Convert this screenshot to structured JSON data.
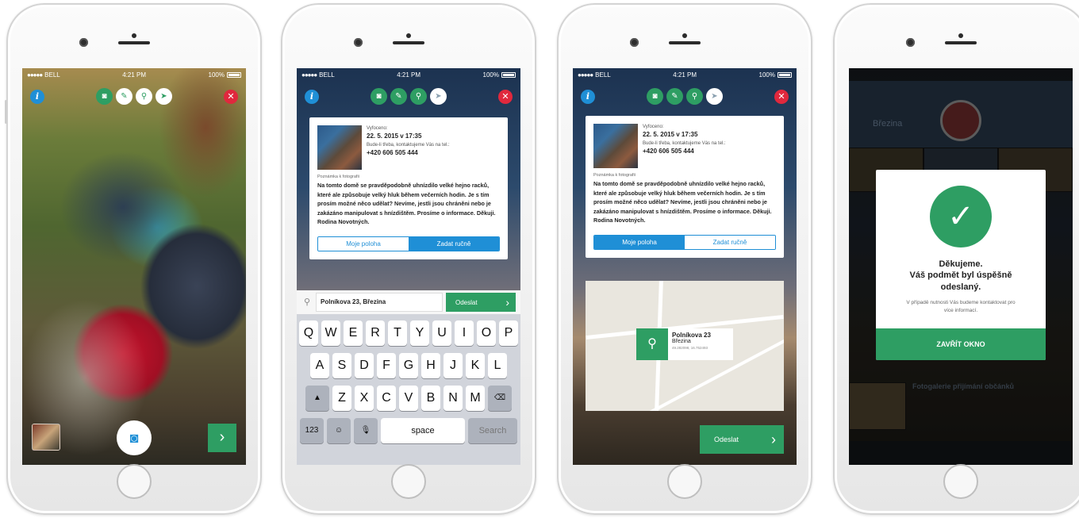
{
  "status": {
    "carrier": "BELL",
    "time": "4:21 PM",
    "battery": "100%"
  },
  "toolbar": {
    "info": "i",
    "close": "✕"
  },
  "screen1": {
    "next": "›"
  },
  "card": {
    "sent_label": "Vyfoceno:",
    "sent_date": "22. 5. 2015 v 17:35",
    "contact_label": "Bude-li třeba, kontaktujeme Vás na tel.:",
    "phone": "+420 606 505 444",
    "note_label": "Poznámka k fotografii",
    "note": "Na tomto domě se pravděpodobně uhnízdilo velké hejno racků, které ale způsobuje velký hluk během večerních hodin. Je s tím prosím možné něco udělat? Nevíme, jestli jsou chráněni nebo je zakázáno manipulovat s hnízdištěm. Prosíme o informace. Děkuji. Rodina Novotných.",
    "location_mine": "Moje poloha",
    "location_manual": "Zadat ručně"
  },
  "screen2": {
    "address_value": "Polníkova 23, Březina",
    "send": "Odeslat",
    "keyboard": {
      "row1": [
        "Q",
        "W",
        "E",
        "R",
        "T",
        "Y",
        "U",
        "I",
        "O",
        "P"
      ],
      "row2": [
        "A",
        "S",
        "D",
        "F",
        "G",
        "H",
        "J",
        "K",
        "L"
      ],
      "row3": [
        "Z",
        "X",
        "C",
        "V",
        "B",
        "N",
        "M"
      ],
      "num": "123",
      "emoji": "☺",
      "mic": "🎙",
      "space": "space",
      "search": "Search"
    }
  },
  "screen3": {
    "map_address": "Polníkova 23",
    "map_town": "Březina",
    "map_coords": "49.282098, 16.752493",
    "send": "Odeslat"
  },
  "screen4": {
    "town": "Březina",
    "thanks_line1": "Děkujeme.",
    "thanks_line2": "Váš podmět byl úspěšně",
    "thanks_line3": "odeslaný.",
    "subtext": "V případě nutnosti Vás budeme kontaktovat pro více informací.",
    "close_window": "ZAVŘÍT OKNO",
    "news_title": "Fotogalerie přijímání občánků"
  }
}
